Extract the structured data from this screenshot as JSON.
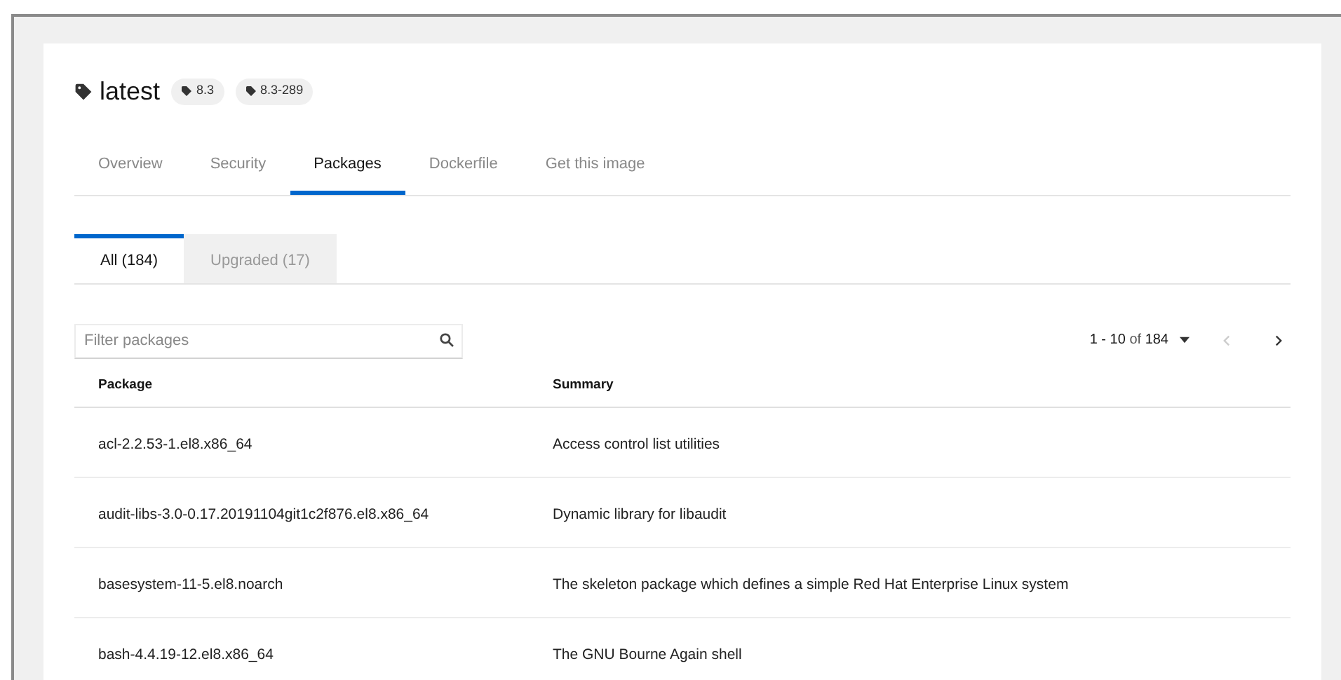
{
  "header": {
    "title": "latest",
    "badges": [
      "8.3",
      "8.3-289"
    ]
  },
  "tabs": [
    {
      "label": "Overview",
      "selected": false
    },
    {
      "label": "Security",
      "selected": false
    },
    {
      "label": "Packages",
      "selected": true
    },
    {
      "label": "Dockerfile",
      "selected": false
    },
    {
      "label": "Get this image",
      "selected": false
    }
  ],
  "subtabs": [
    {
      "label": "All (184)",
      "selected": true
    },
    {
      "label": "Upgraded (17)",
      "selected": false
    }
  ],
  "filter": {
    "placeholder": "Filter packages"
  },
  "pagination": {
    "range": "1 - 10",
    "of": "of",
    "total": "184",
    "prev_disabled": true,
    "next_disabled": false
  },
  "table": {
    "columns": [
      "Package",
      "Summary"
    ],
    "rows": [
      [
        "acl-2.2.53-1.el8.x86_64",
        "Access control list utilities"
      ],
      [
        "audit-libs-3.0-0.17.20191104git1c2f876.el8.x86_64",
        "Dynamic library for libaudit"
      ],
      [
        "basesystem-11-5.el8.noarch",
        "The skeleton package which defines a simple Red Hat Enterprise Linux system"
      ],
      [
        "bash-4.4.19-12.el8.x86_64",
        "The GNU Bourne Again shell"
      ]
    ]
  }
}
